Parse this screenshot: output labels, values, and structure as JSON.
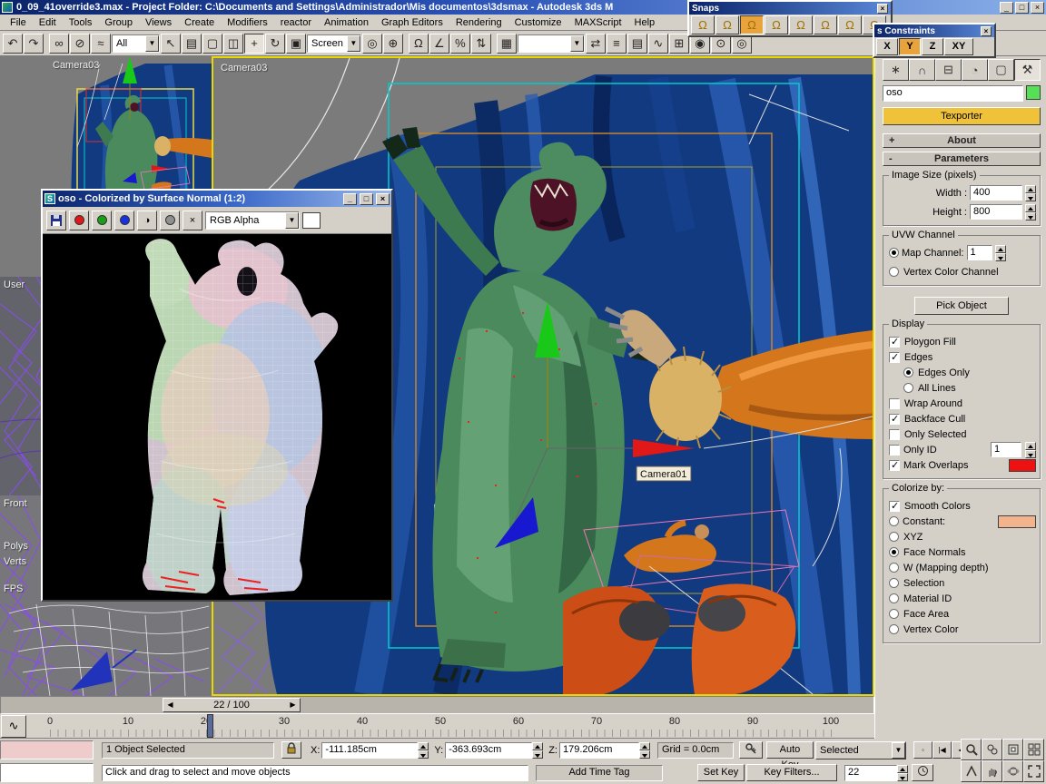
{
  "titlebar": {
    "title": "0_09_41override3.max    - Project Folder: C:\\Documents and Settings\\Administrador\\Mis documentos\\3dsmax    - Autodesk 3ds M"
  },
  "menubar": {
    "items": [
      "File",
      "Edit",
      "Tools",
      "Group",
      "Views",
      "Create",
      "Modifiers",
      "reactor",
      "Animation",
      "Graph Editors",
      "Rendering",
      "Customize",
      "MAXScript",
      "Help"
    ]
  },
  "toolbar": {
    "selection_filter": "All",
    "coord_system": "Screen"
  },
  "snaps_toolbar": {
    "title": "Snaps"
  },
  "axis_toolbar": {
    "title": "s Constraints",
    "x": "X",
    "y": "Y",
    "z": "Z",
    "xy": "XY"
  },
  "viewports": {
    "small_camera": {
      "label": "Camera03"
    },
    "user": {
      "label": "User"
    },
    "front": {
      "label": "Front",
      "stat_polys": "Polys",
      "stat_verts": "Verts",
      "stat_fps": "FPS"
    },
    "main_camera": {
      "label": "Camera03",
      "camera_tag": "Camera01"
    }
  },
  "render_window": {
    "title": "oso - Colorized by Surface Normal (1:2)",
    "channel": "RGB Alpha"
  },
  "panel": {
    "object_name": "oso",
    "texporter": "Texporter",
    "about": "About",
    "about_state": "+",
    "parameters": "Parameters",
    "parameters_state": "-",
    "image_size": {
      "legend": "Image Size (pixels)",
      "width_label": "Width :",
      "width_value": "400",
      "height_label": "Height :",
      "height_value": "800"
    },
    "uvw": {
      "legend": "UVW Channel",
      "map_channel": "Map Channel:",
      "map_value": "1",
      "vertex_color": "Vertex Color Channel"
    },
    "pick_object": "Pick Object",
    "display": {
      "legend": "Display",
      "polygon_fill": "Ploygon Fill",
      "edges": "Edges",
      "edges_only": "Edges Only",
      "all_lines": "All Lines",
      "wrap_around": "Wrap Around",
      "backface_cull": "Backface Cull",
      "only_selected": "Only Selected",
      "only_id": "Only ID",
      "only_id_value": "1",
      "mark_overlaps": "Mark Overlaps"
    },
    "colorize": {
      "legend": "Colorize by:",
      "smooth": "Smooth Colors",
      "constant": "Constant:",
      "xyz": "XYZ",
      "face_normals": "Face Normals",
      "w_depth": "W (Mapping depth)",
      "selection": "Selection",
      "material_id": "Material ID",
      "face_area": "Face Area",
      "vertex_color": "Vertex Color"
    }
  },
  "timeline": {
    "thumb": "22 / 100"
  },
  "ruler": {
    "ticks": [
      "0",
      "10",
      "20",
      "30",
      "40",
      "50",
      "60",
      "70",
      "80",
      "90",
      "100"
    ]
  },
  "statusbar": {
    "selection": "1 Object Selected",
    "x_label": "X:",
    "x_value": "-111.185cm",
    "y_label": "Y:",
    "y_value": "-363.693cm",
    "z_label": "Z:",
    "z_value": "179.206cm",
    "grid": "Grid = 0.0cm",
    "prompt": "Click and drag to select and move objects",
    "add_time_tag": "Add Time Tag",
    "auto_key": "Auto Key",
    "set_key": "Set Key",
    "selected_dd": "Selected",
    "key_filters": "Key Filters...",
    "frame": "22"
  },
  "colors": {
    "texporter_yellow": "#efc23a",
    "object_color_green": "#55e055",
    "mark_overlaps_red": "#ee1111",
    "constant_peach": "#f2b48c",
    "active_viewport_border": "#e8d800",
    "snap_active_orange": "#e8a33c"
  },
  "icons": {
    "undo": "↶",
    "redo": "↷",
    "link": "∞",
    "unlink": "⊘",
    "bind": "≈",
    "select": "↖",
    "select_name": "▤",
    "region": "▢",
    "crossing": "◫",
    "move": "+",
    "rotate": "↻",
    "scale": "▣",
    "pivot": "◎",
    "manipulate": "⊕",
    "magnet": "Ω",
    "angle": "∠",
    "percent": "%",
    "spinner_snap": "⇅",
    "sets": "▦",
    "mirror": "⇄",
    "align": "≡",
    "layers": "▤",
    "curve": "∿",
    "schematic": "⊞",
    "material": "◉",
    "rendersetup": "⊙",
    "quickrender": "◎",
    "tab_create": "∗",
    "tab_modify": "∩",
    "tab_hier": "⊟",
    "tab_motion": "◔",
    "tab_display": "▢",
    "tab_util": "⚒",
    "alpha": "◑",
    "mono": "●",
    "clear": "×",
    "dd_arrow": "▼",
    "min": "_",
    "max": "□",
    "close": "×",
    "ts_left": "◀",
    "ts_right": "▶",
    "pb_keymode": "◦",
    "pb_start": "|◀",
    "pb_prev": "◀",
    "pb_play": "▶",
    "pb_next": "▶",
    "pb_end": "▶|"
  }
}
